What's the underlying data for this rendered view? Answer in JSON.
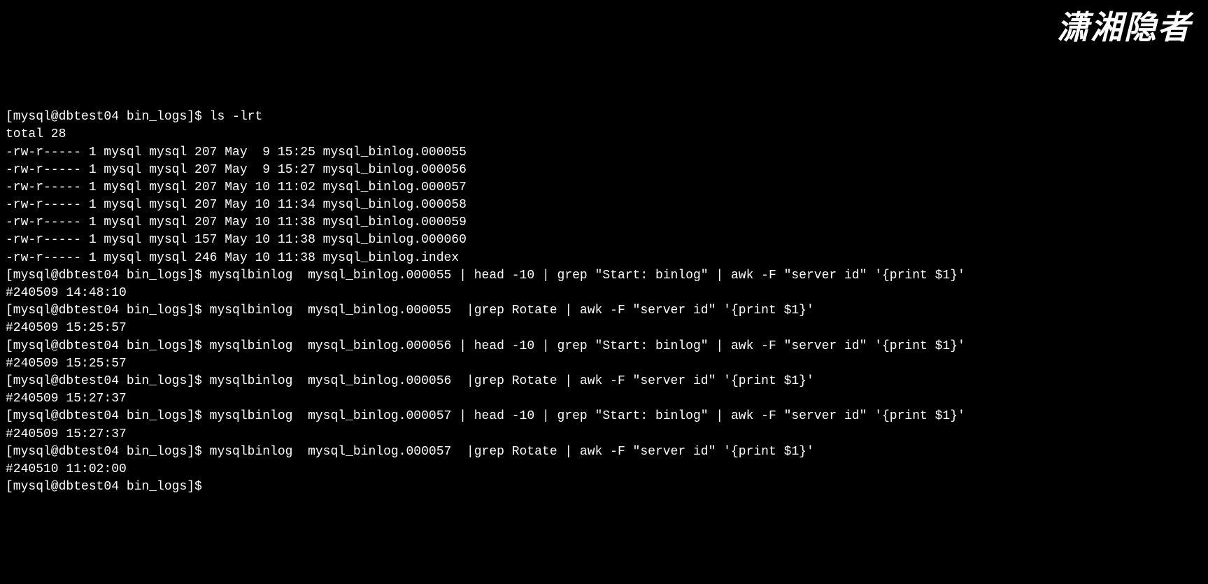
{
  "watermark": "潇湘隐者",
  "prompt": "[mysql@dbtest04 bin_logs]$ ",
  "lines": [
    {
      "type": "cmd",
      "text": "ls -lrt"
    },
    {
      "type": "out",
      "text": "total 28"
    },
    {
      "type": "out",
      "text": "-rw-r----- 1 mysql mysql 207 May  9 15:25 mysql_binlog.000055"
    },
    {
      "type": "out",
      "text": "-rw-r----- 1 mysql mysql 207 May  9 15:27 mysql_binlog.000056"
    },
    {
      "type": "out",
      "text": "-rw-r----- 1 mysql mysql 207 May 10 11:02 mysql_binlog.000057"
    },
    {
      "type": "out",
      "text": "-rw-r----- 1 mysql mysql 207 May 10 11:34 mysql_binlog.000058"
    },
    {
      "type": "out",
      "text": "-rw-r----- 1 mysql mysql 207 May 10 11:38 mysql_binlog.000059"
    },
    {
      "type": "out",
      "text": "-rw-r----- 1 mysql mysql 157 May 10 11:38 mysql_binlog.000060"
    },
    {
      "type": "out",
      "text": "-rw-r----- 1 mysql mysql 246 May 10 11:38 mysql_binlog.index"
    },
    {
      "type": "cmd",
      "text": "mysqlbinlog  mysql_binlog.000055 | head -10 | grep \"Start: binlog\" | awk -F \"server id\" '{print $1}'"
    },
    {
      "type": "out",
      "text": "#240509 14:48:10"
    },
    {
      "type": "cmd",
      "text": "mysqlbinlog  mysql_binlog.000055  |grep Rotate | awk -F \"server id\" '{print $1}'"
    },
    {
      "type": "out",
      "text": "#240509 15:25:57"
    },
    {
      "type": "cmd",
      "text": "mysqlbinlog  mysql_binlog.000056 | head -10 | grep \"Start: binlog\" | awk -F \"server id\" '{print $1}'"
    },
    {
      "type": "out",
      "text": "#240509 15:25:57"
    },
    {
      "type": "cmd",
      "text": "mysqlbinlog  mysql_binlog.000056  |grep Rotate | awk -F \"server id\" '{print $1}'"
    },
    {
      "type": "out",
      "text": "#240509 15:27:37"
    },
    {
      "type": "cmd",
      "text": "mysqlbinlog  mysql_binlog.000057 | head -10 | grep \"Start: binlog\" | awk -F \"server id\" '{print $1}'"
    },
    {
      "type": "out",
      "text": "#240509 15:27:37"
    },
    {
      "type": "cmd",
      "text": "mysqlbinlog  mysql_binlog.000057  |grep Rotate | awk -F \"server id\" '{print $1}'"
    },
    {
      "type": "out",
      "text": "#240510 11:02:00"
    },
    {
      "type": "cmd",
      "text": ""
    }
  ]
}
